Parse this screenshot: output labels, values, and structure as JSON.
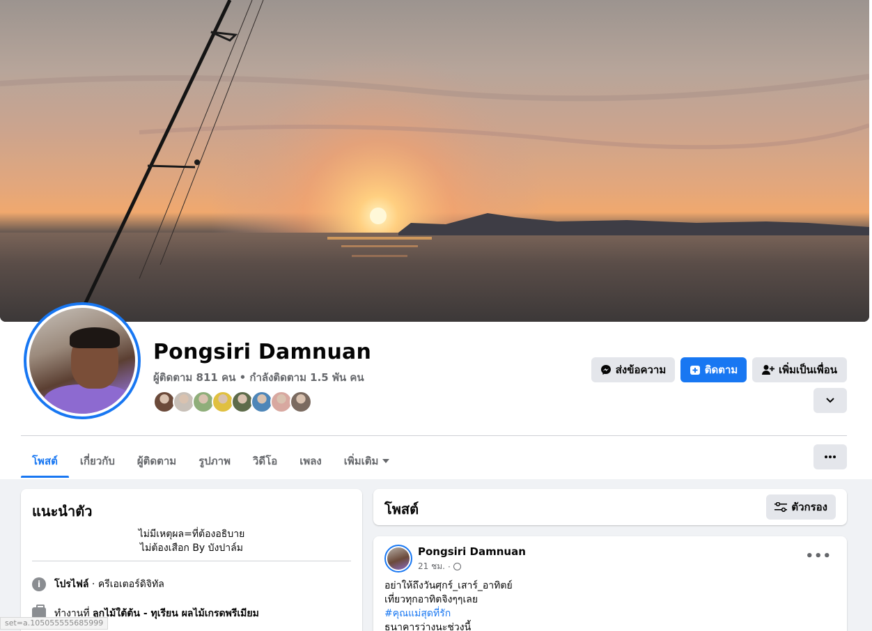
{
  "profile": {
    "name": "Pongsiri Damnuan",
    "follow_stats": "ผู้ติดตาม 811 คน • กำลังติดตาม 1.5 พัน คน",
    "friend_avatar_colors": [
      "#6b4a3a",
      "#c8c0b8",
      "#8fae7a",
      "#e0c040",
      "#5d6b4a",
      "#4e86b8",
      "#d8a8a0",
      "#7a6a60"
    ]
  },
  "actions": {
    "message": "ส่งข้อความ",
    "follow": "ติดตาม",
    "add_friend": "เพิ่มเป็นเพื่อน"
  },
  "tabs": [
    {
      "label": "โพสต์",
      "active": true
    },
    {
      "label": "เกี่ยวกับ"
    },
    {
      "label": "ผู้ติดตาม"
    },
    {
      "label": "รูปภาพ"
    },
    {
      "label": "วิดีโอ"
    },
    {
      "label": "เพลง"
    },
    {
      "label": "เพิ่มเติม"
    }
  ],
  "intro": {
    "title": "แนะนำตัว",
    "bio_line1": "ไม่มีเหตุผล=ที่ต้องอธิบาย",
    "bio_line2": "ไม่ต้องเสือก By บังปาล์ม",
    "profile_label": "โปรไฟล์",
    "profile_value": " · ครีเอเตอร์ดิจิทัล",
    "work_prefix": "ทำงานที่ ",
    "work_value": "ลูกไม้ใต้ต้น - ทุเรียน ผลไม้เกรดพรีเมียม"
  },
  "posts": {
    "title": "โพสต์",
    "filter": "ตัวกรอง"
  },
  "post": {
    "author": "Pongsiri Damnuan",
    "time": "21 ชม.",
    "line1": "อย่าให้ถึงวันศุกร์_เสาร์_อาทิตย์",
    "line2": "เที่ยวทุกอาทิตจิงๆๆเลย",
    "hashtag": "#คุณแม่สุดที่รัก",
    "line4": "ธนาคารว่างนะช่วงนี้"
  },
  "status_url": "set=a.105055555685999"
}
